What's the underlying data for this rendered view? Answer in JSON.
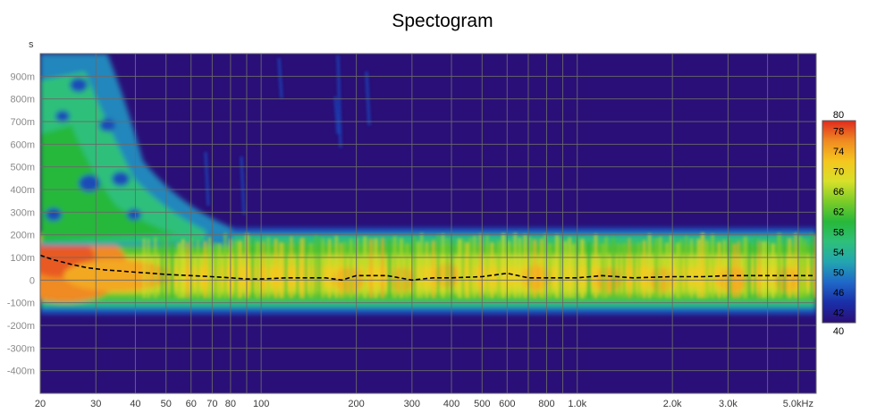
{
  "chart_data": {
    "type": "heatmap",
    "title": "Spectogram",
    "ylabel": "s",
    "x_scale": "log",
    "xlim": [
      20,
      5700
    ],
    "x_ticks": [
      {
        "value": 20,
        "label": "20"
      },
      {
        "value": 30,
        "label": "30"
      },
      {
        "value": 40,
        "label": "40"
      },
      {
        "value": 50,
        "label": "50"
      },
      {
        "value": 60,
        "label": "60"
      },
      {
        "value": 70,
        "label": "70"
      },
      {
        "value": 80,
        "label": "80"
      },
      {
        "value": 100,
        "label": "100"
      },
      {
        "value": 200,
        "label": "200"
      },
      {
        "value": 300,
        "label": "300"
      },
      {
        "value": 400,
        "label": "400"
      },
      {
        "value": 500,
        "label": "500"
      },
      {
        "value": 600,
        "label": "600"
      },
      {
        "value": 800,
        "label": "800"
      },
      {
        "value": 1000,
        "label": "1.0k"
      },
      {
        "value": 2000,
        "label": "2.0k"
      },
      {
        "value": 3000,
        "label": "3.0k"
      },
      {
        "value": 5000,
        "label": "5.0kHz"
      }
    ],
    "ylim": [
      -0.5,
      1.0
    ],
    "y_ticks": [
      {
        "value": 0.9,
        "label": "900m"
      },
      {
        "value": 0.8,
        "label": "800m"
      },
      {
        "value": 0.7,
        "label": "700m"
      },
      {
        "value": 0.6,
        "label": "600m"
      },
      {
        "value": 0.5,
        "label": "500m"
      },
      {
        "value": 0.4,
        "label": "400m"
      },
      {
        "value": 0.3,
        "label": "300m"
      },
      {
        "value": 0.2,
        "label": "200m"
      },
      {
        "value": 0.1,
        "label": "100m"
      },
      {
        "value": 0.0,
        "label": "0"
      },
      {
        "value": -0.1,
        "label": "-100m"
      },
      {
        "value": -0.2,
        "label": "-200m"
      },
      {
        "value": -0.3,
        "label": "-300m"
      },
      {
        "value": -0.4,
        "label": "-400m"
      }
    ],
    "grid": true,
    "colorbar": {
      "min": 40,
      "max": 80,
      "labels": [
        "80",
        "78",
        "74",
        "70",
        "66",
        "62",
        "58",
        "54",
        "50",
        "46",
        "42",
        "40"
      ],
      "label_values": [
        80,
        78,
        74,
        70,
        66,
        62,
        58,
        54,
        50,
        46,
        42,
        40
      ],
      "stops": [
        {
          "value": 40,
          "color": "#2a0f78"
        },
        {
          "value": 44,
          "color": "#1a2fa8"
        },
        {
          "value": 48,
          "color": "#1f68c8"
        },
        {
          "value": 52,
          "color": "#23a5b0"
        },
        {
          "value": 56,
          "color": "#2ec07a"
        },
        {
          "value": 60,
          "color": "#28b83a"
        },
        {
          "value": 64,
          "color": "#7ccc28"
        },
        {
          "value": 68,
          "color": "#d8e02a"
        },
        {
          "value": 72,
          "color": "#f5c61e"
        },
        {
          "value": 76,
          "color": "#f08a22"
        },
        {
          "value": 80,
          "color": "#e02a1e"
        }
      ]
    },
    "peak_time_curve": {
      "style": "dashed",
      "color": "#000000",
      "x": [
        20,
        22,
        25,
        28,
        32,
        36,
        40,
        45,
        50,
        60,
        70,
        80,
        90,
        100,
        120,
        140,
        160,
        180,
        200,
        250,
        300,
        350,
        400,
        500,
        600,
        700,
        800,
        1000,
        1200,
        1500,
        2000,
        2500,
        3000,
        4000,
        5000,
        5600
      ],
      "y": [
        0.11,
        0.09,
        0.07,
        0.055,
        0.045,
        0.04,
        0.035,
        0.03,
        0.025,
        0.02,
        0.015,
        0.01,
        0.005,
        0.005,
        0.01,
        0.01,
        0.01,
        0.0,
        0.02,
        0.02,
        0.0,
        0.01,
        0.01,
        0.015,
        0.03,
        0.01,
        0.01,
        0.01,
        0.02,
        0.01,
        0.015,
        0.015,
        0.02,
        0.02,
        0.02,
        0.02
      ]
    }
  }
}
